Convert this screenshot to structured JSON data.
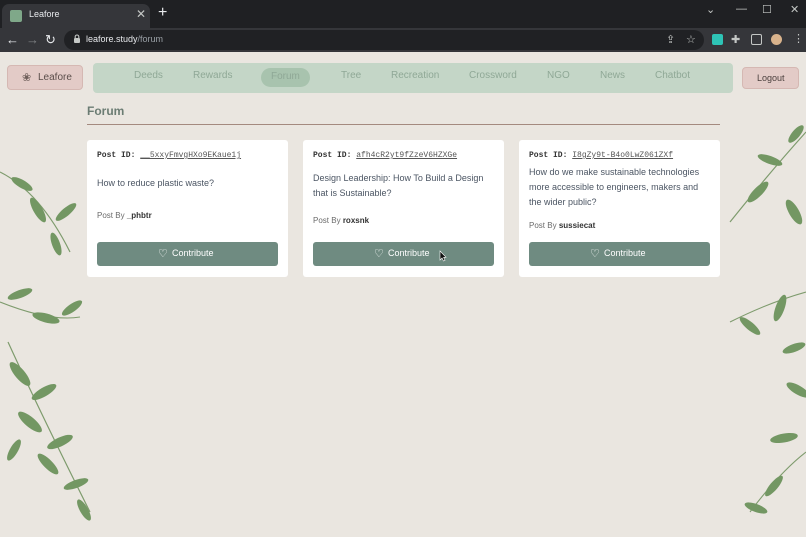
{
  "browser": {
    "tab_title": "Leafore",
    "url_host": "leafore.study",
    "url_path": "/forum"
  },
  "site": {
    "brand_label": "Leafore",
    "logout_label": "Logout",
    "nav": [
      {
        "label": "Deeds",
        "active": false
      },
      {
        "label": "Rewards",
        "active": false
      },
      {
        "label": "Forum",
        "active": true
      },
      {
        "label": "Tree",
        "active": false
      },
      {
        "label": "Recreation",
        "active": false
      },
      {
        "label": "Crossword",
        "active": false
      },
      {
        "label": "NGO",
        "active": false
      },
      {
        "label": "News",
        "active": false
      },
      {
        "label": "Chatbot",
        "active": false
      }
    ]
  },
  "forum": {
    "title": "Forum",
    "post_id_label": "Post ID:",
    "post_by_label": "Post By",
    "contribute_label": "Contribute",
    "posts": [
      {
        "id": "__5xxyFmvgHXo9EKaue1j",
        "question": "How to reduce plastic waste?",
        "author": "_phbtr"
      },
      {
        "id": "afh4cR2yt9fZzeV6HZXGe",
        "question": "Design Leadership: How To Build a Design that is Sustainable?",
        "author": "roxsnk"
      },
      {
        "id": "I8gZy9t-B4o0LwZ061ZXf",
        "question": "How do we make sustainable technologies more accessible to engineers, makers and the wider public?",
        "author": "sussiecat"
      }
    ]
  },
  "colors": {
    "accent": "#6f8b81",
    "nav_bg": "#c4d6c7",
    "button_pink": "#e3cbc7",
    "page_bg": "#eae6e0"
  },
  "icons": {
    "brand": "lotus-icon",
    "contribute": "heart-outline-icon"
  }
}
